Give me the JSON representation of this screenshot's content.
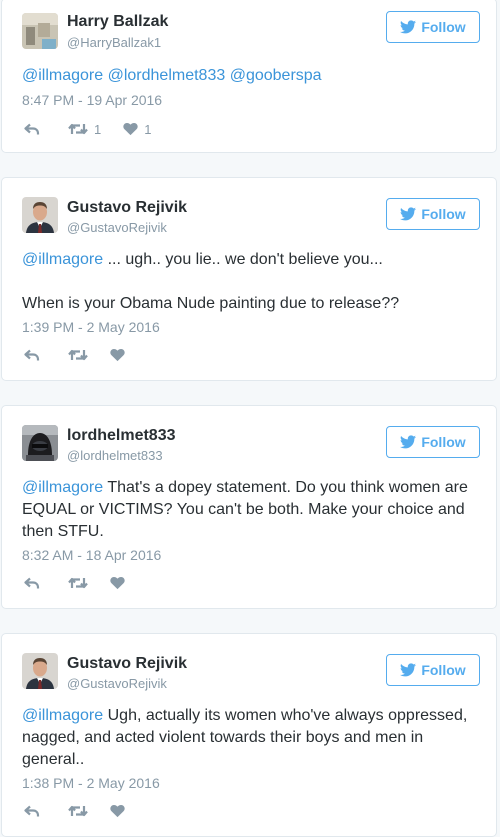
{
  "follow_label": "Follow",
  "tweets": [
    {
      "name": "Harry Ballzak",
      "handle": "@HarryBallzak1",
      "mentions": [
        "@illmagore",
        "@lordhelmet833",
        "@gooberspa"
      ],
      "time": "8:47 PM - 19 Apr 2016",
      "retweets": "1",
      "likes": "1"
    },
    {
      "name": "Gustavo Rejivik",
      "handle": "@GustavoRejivik",
      "mention": "@illmagore",
      "text": "... ugh.. you lie.. we don't believe you...",
      "text2": "When is your Obama Nude painting due to release??",
      "time": "1:39 PM - 2 May 2016"
    },
    {
      "name": "lordhelmet833",
      "handle": "@lordhelmet833",
      "mention": "@illmagore",
      "text": "That's a dopey statement. Do you think women are EQUAL or VICTIMS? You can't be both. Make your choice and then STFU.",
      "time": "8:32 AM - 18 Apr 2016"
    },
    {
      "name": "Gustavo Rejivik",
      "handle": "@GustavoRejivik",
      "mention": "@illmagore",
      "text": "Ugh, actually its women who've always oppressed, nagged, and acted violent towards their boys and men in general..",
      "time": "1:38 PM - 2 May 2016"
    }
  ]
}
